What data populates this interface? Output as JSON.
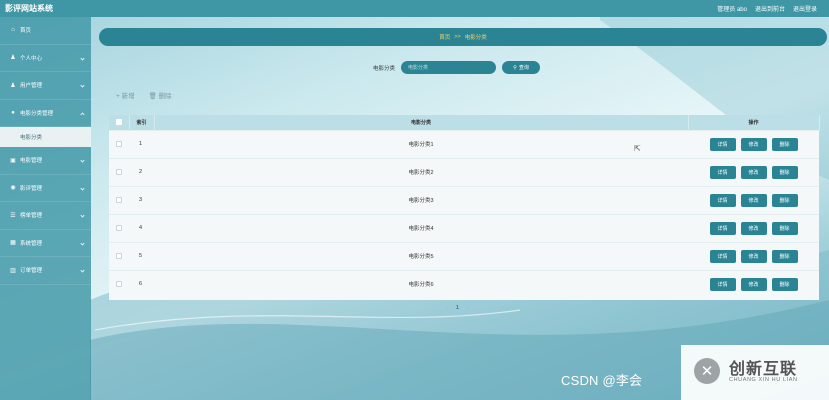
{
  "header": {
    "title": "影评网站系统",
    "admin_label": "管理员 abo",
    "backend_link": "退出到前台",
    "logout_link": "退出登录"
  },
  "sidebar": {
    "items": [
      {
        "label": "首页",
        "icon": "home-icon"
      },
      {
        "label": "个人中心",
        "icon": "user-icon"
      },
      {
        "label": "用户管理",
        "icon": "user-icon"
      },
      {
        "label": "电影分类管理",
        "icon": "pin-icon"
      },
      {
        "label": "电影管理",
        "icon": "film-icon"
      },
      {
        "label": "影评管理",
        "icon": "comment-icon"
      },
      {
        "label": "榜单管理",
        "icon": "list-icon"
      },
      {
        "label": "系统管理",
        "icon": "grid-icon"
      },
      {
        "label": "订单管理",
        "icon": "chart-icon"
      }
    ],
    "sub_item": "电影分类"
  },
  "breadcrumb": {
    "home": "首页",
    "separator": ">>",
    "current": "电影分类"
  },
  "search": {
    "label": "电影分类",
    "placeholder": "电影分类",
    "button": "查询"
  },
  "actions": {
    "add": "+ 新增",
    "delete": "删除"
  },
  "table": {
    "headers": {
      "index": "索引",
      "category": "电影分类",
      "ops": "操作"
    },
    "rows": [
      {
        "index": "1",
        "category": "电影分类1"
      },
      {
        "index": "2",
        "category": "电影分类2"
      },
      {
        "index": "3",
        "category": "电影分类3"
      },
      {
        "index": "4",
        "category": "电影分类4"
      },
      {
        "index": "5",
        "category": "电影分类5"
      },
      {
        "index": "6",
        "category": "电影分类6"
      }
    ],
    "buttons": {
      "detail": "详情",
      "edit": "修改",
      "remove": "删除"
    }
  },
  "pagination": {
    "prev": "‹",
    "current": "1",
    "next": "›"
  },
  "overlay": {
    "watermark": "CSDN @李会",
    "logo_main": "创新互联",
    "logo_sub": "CHUANG XIN HU LIAN"
  },
  "colors": {
    "primary": "#2a8494",
    "header": "#3f97a6",
    "accent": "#f6d36a"
  }
}
